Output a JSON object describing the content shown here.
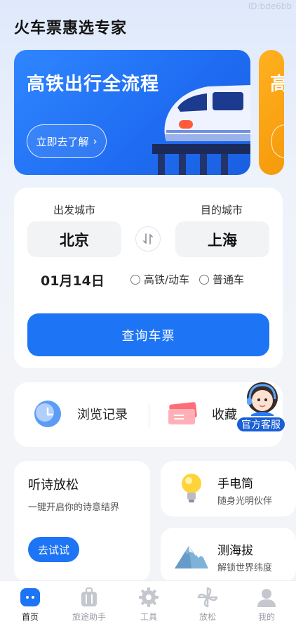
{
  "watermark": "ID:bde6bb",
  "app": {
    "title": "火车票惠选专家"
  },
  "banner": {
    "title": "高铁出行全流程",
    "button_label": "立即去了解",
    "button_chevron": "›",
    "next_title": "高"
  },
  "search": {
    "from_label": "出发城市",
    "to_label": "目的城市",
    "from_city": "北京",
    "to_city": "上海",
    "date": "01月14日",
    "train_types": [
      "高铁/动车",
      "普通车"
    ],
    "query_button": "查询车票"
  },
  "shortcuts": {
    "history": "浏览记录",
    "favorites": "收藏"
  },
  "service": {
    "label": "官方客服"
  },
  "poem": {
    "title": "听诗放松",
    "subtitle": "一键开启你的诗意结界",
    "button": "去试试"
  },
  "tools": [
    {
      "title": "手电筒",
      "subtitle": "随身光明伙伴",
      "icon": "lightbulb-icon"
    },
    {
      "title": "测海拔",
      "subtitle": "解锁世界纬度",
      "icon": "mountain-icon"
    }
  ],
  "tabbar": {
    "items": [
      {
        "label": "首页",
        "icon": "home-icon",
        "active": true
      },
      {
        "label": "旅途助手",
        "icon": "luggage-icon",
        "active": false
      },
      {
        "label": "工具",
        "icon": "gear-icon",
        "active": false
      },
      {
        "label": "放松",
        "icon": "pinwheel-icon",
        "active": false
      },
      {
        "label": "我的",
        "icon": "profile-icon",
        "active": false
      }
    ]
  },
  "colors": {
    "primary": "#1d74f5",
    "banner_blue": "#2f86ff",
    "banner_orange": "#f59a0b",
    "tab_active": "#1f1f1f",
    "tab_inactive": "#9a9ea6"
  }
}
